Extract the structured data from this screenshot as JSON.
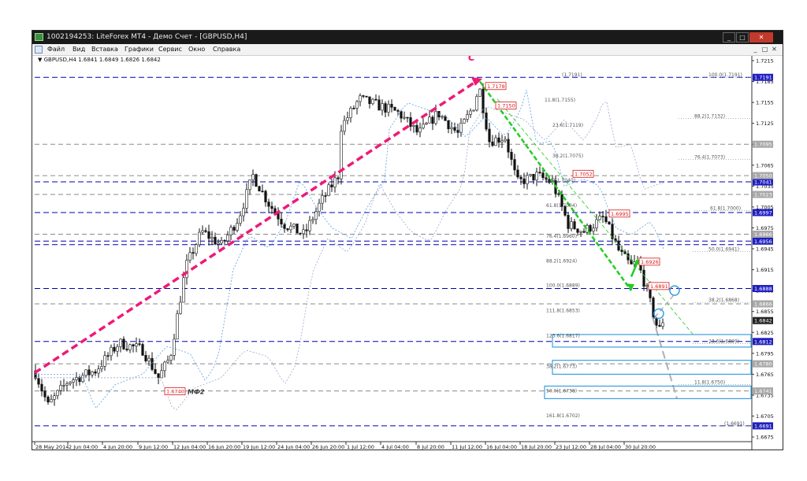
{
  "window": {
    "title": "1002194253: LiteForex MT4 - Демо Счет - [GBPUSD,H4]",
    "buttons": [
      "_",
      "□",
      "✕"
    ]
  },
  "menu": {
    "items": [
      "Файл",
      "Вид",
      "Вставка",
      "Графики",
      "Сервис",
      "Окно",
      "Справка"
    ],
    "right_controls": [
      "_",
      "□",
      "✕"
    ]
  },
  "chart": {
    "symbol_header": "GBPUSD,H4  1.6841 1.6849 1.6826 1.6842",
    "marker_c": "C",
    "marker_mf2": "МФ2",
    "colors": {
      "grid_blue": "#0000b4",
      "grid_gray": "#8a8a8a",
      "pink_trend": "#ee1a78",
      "green_channel": "#22cc22",
      "price_box_blue": "#3aa0e0",
      "red_label": "#d81818",
      "label_blue_bg": "#1f1fbf",
      "label_gray_bg": "#a8a8a8"
    },
    "price_axis": [
      "1.7215",
      "1.7185",
      "1.7155",
      "1.7125",
      "1.7095",
      "1.7065",
      "1.7035",
      "1.7005",
      "1.6975",
      "1.6945",
      "1.6915",
      "1.6885",
      "1.6855",
      "1.6825",
      "1.6795",
      "1.6765",
      "1.6735",
      "1.6705",
      "1.6675"
    ],
    "date_axis": [
      "28 May 2014",
      "2 Jun 04:00",
      "4 Jun 20:00",
      "9 Jun 12:00",
      "12 Jun 04:00",
      "16 Jun 20:00",
      "19 Jun 12:00",
      "24 Jun 04:00",
      "26 Jun 20:00",
      "1 Jul 12:00",
      "4 Jul 04:00",
      "8 Jul 20:00",
      "11 Jul 12:00",
      "16 Jul 04:00",
      "18 Jul 20:00",
      "23 Jul 12:00",
      "28 Jul 04:00",
      "30 Jul 20:00"
    ],
    "axis_labels_blue": [
      "1.7191",
      "1.7041",
      "1.6997",
      "1.6956",
      "1.6888",
      "1.6812",
      "1.6691"
    ],
    "axis_labels_gray": [
      "1.7095",
      "1.7050",
      "1.7023",
      "1.6966",
      "1.6866",
      "1.6842",
      "1.6780",
      "1.6741"
    ],
    "red_labels": [
      "1.7178",
      "1.7150",
      "1.7052",
      "1.6995",
      "1.6926",
      "1.6891",
      "1.6740"
    ],
    "fibo_left": [
      "(1.7191)",
      "11.8(1.7155)",
      "23.6(1.7119)",
      "38.2(1.7075)",
      "50.0(1.7040)",
      "61.8(1.7004)",
      "76.4(1.6960)",
      "88.2(1.6924)",
      "100.0(1.6889)",
      "111.8(1.6853)",
      "123.6(1.6817)",
      "38.2(1.6773)",
      "50.0(1.6738)",
      "161.8(1.6702)"
    ],
    "fibo_right": [
      "100.0(1.7191)",
      "88.2(1.7132)",
      "76.4(1.7073)",
      "61.8(1.7000)",
      "50.0(1.6941)",
      "38.2(1.6868)",
      "23.6(1.6809)",
      "11.8(1.6750)",
      "(1.6691)"
    ]
  }
}
